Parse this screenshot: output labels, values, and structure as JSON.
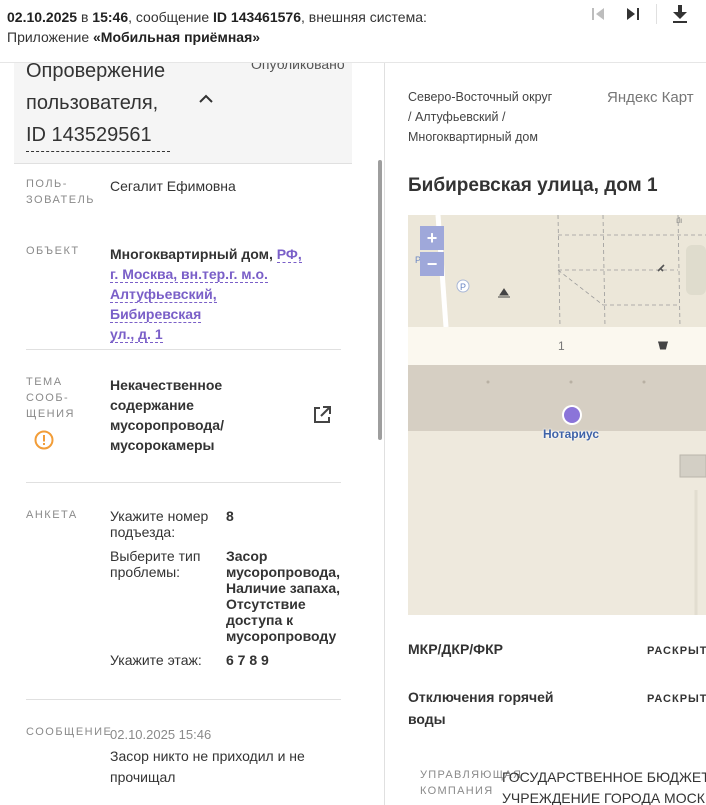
{
  "topbar": {
    "date": "02.10.2025",
    "in_word": "в",
    "time": "15:46",
    "message_word": ", сообщение",
    "message_id": "ID 143461576",
    "system_text": ", внешняя система:",
    "app_prefix": "Приложение",
    "app_name": "«Мобильная приёмная»"
  },
  "header": {
    "title_line1": "Опровержение",
    "title_line2": "пользователя,",
    "title_id": "ID 143529561",
    "status": "Опубликовано"
  },
  "user": {
    "label_1": "ПОЛЬ-",
    "label_2": "ЗОВАТЕЛЬ",
    "name": "Сегалит Ефимовна"
  },
  "object": {
    "label": "ОБЪЕКТ",
    "type": "Многоквартирный дом,",
    "address_1": "РФ,",
    "address_2": "г. Москва, вн.тер.г. м.о.",
    "address_3": "Алтуфьевский, Бибиревская",
    "address_4": "ул., д. 1"
  },
  "topic": {
    "label_1": "ТЕМА",
    "label_2": "СООБ-",
    "label_3": "ЩЕНИЯ",
    "line1": "Некачественное",
    "line2": "содержание",
    "line3": "мусоропровода/",
    "line4": "мусорокамеры"
  },
  "survey": {
    "label": "АНКЕТА",
    "q1": "Укажите номер подъезда:",
    "a1": "8",
    "q2": "Выберите тип проблемы:",
    "a2_1": "Засор",
    "a2_2": "мусоропровода,",
    "a2_3": "Наличие запаха,",
    "a2_4": "Отсутствие",
    "a2_5": "доступа к",
    "a2_6": "мусоропроводу",
    "q3": "Укажите этаж:",
    "a3": "6 7 8 9"
  },
  "message": {
    "label": "СООБЩЕНИЕ",
    "date": "02.10.2025 15:46",
    "text": "Засор никто не приходил и не прочищал"
  },
  "right": {
    "breadcrumb_1": "Северо-Восточный округ",
    "breadcrumb_2": "/ Алтуфьевский /",
    "breadcrumb_3": "Многоквартирный дом",
    "map_provider": "Яндекс Карт",
    "address": "Бибиревская улица, дом 1",
    "map_house_number": "1",
    "map_poi_label": "Нотариус",
    "zoom_in": "+",
    "zoom_out": "−",
    "map_p_label": "P",
    "sections": [
      {
        "title": "МКР/ДКР/ФКР",
        "action": "РАСКРЫТЬ"
      },
      {
        "title_1": "Отключения горячей",
        "title_2": "воды",
        "action": "РАСКРЫТЬ"
      }
    ],
    "uk_label_1": "УПРАВЛЯЮЩАЯ",
    "uk_label_2": "КОМПАНИЯ",
    "uk_value_1": "ГОСУДАРСТВЕННОЕ БЮДЖЕТНО",
    "uk_value_2": "УЧРЕЖДЕНИЕ ГОРОДА МОСКВЫ"
  },
  "colors": {
    "accent": "#7a5fc8",
    "warning": "#f29d38",
    "zoom": "#9fa8da"
  },
  "icons": [
    "skip-first-icon",
    "skip-next-icon",
    "download-icon",
    "chevron-up-icon",
    "warning-icon",
    "external-link-icon",
    "map-pin-icon"
  ]
}
